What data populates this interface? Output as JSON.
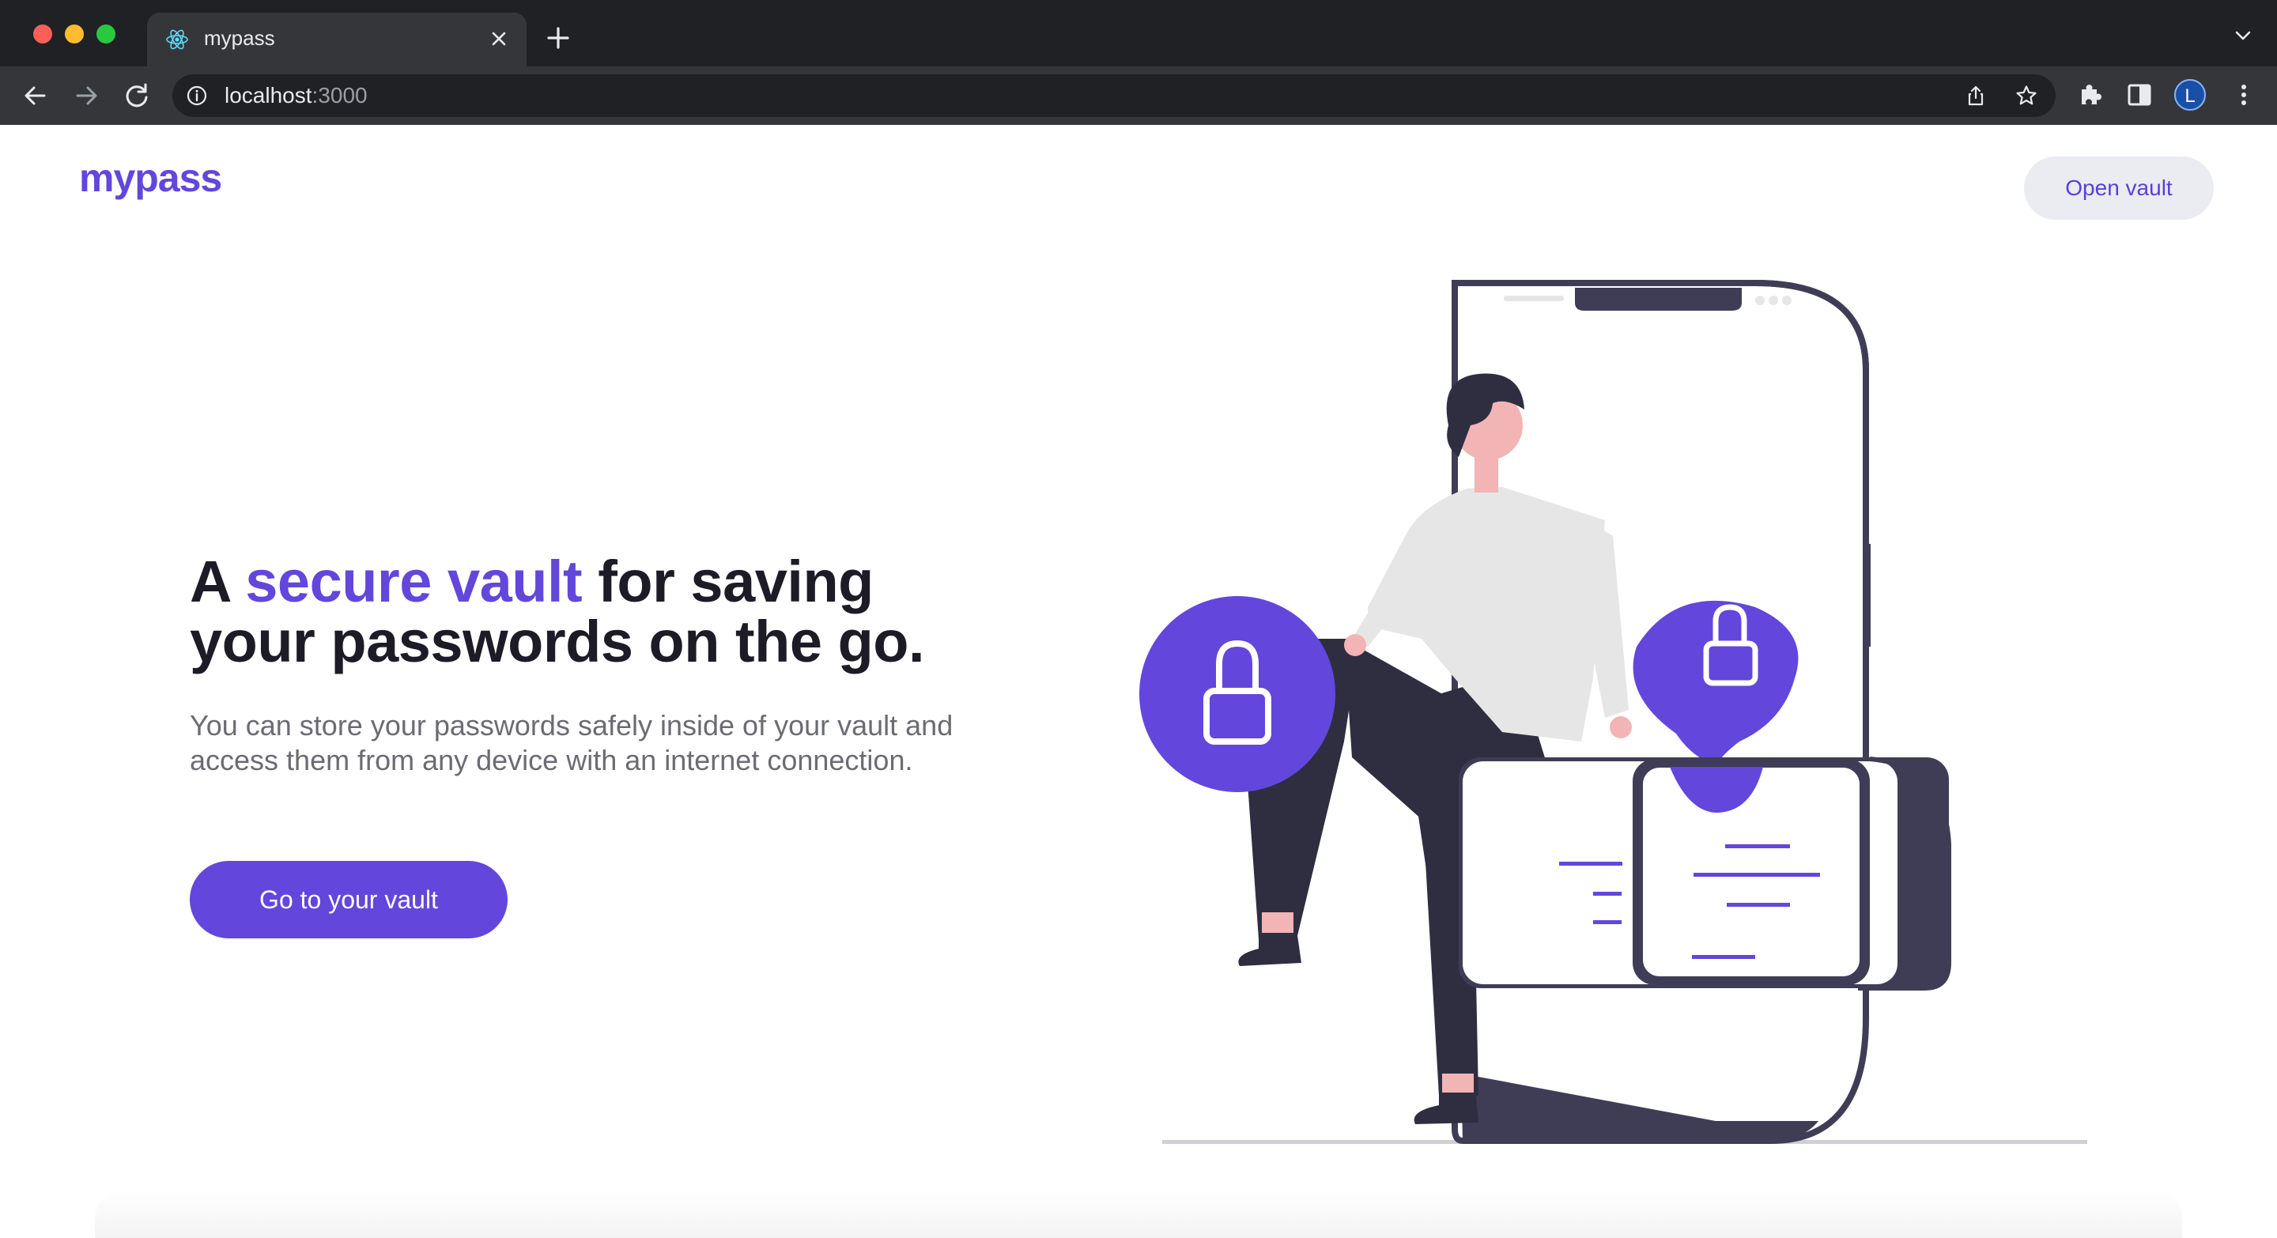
{
  "browser": {
    "tab_title": "mypass",
    "url_host": "localhost",
    "url_port": ":3000",
    "avatar_initial": "L"
  },
  "header": {
    "logo": "mypass",
    "open_vault_label": "Open vault"
  },
  "hero": {
    "title_prefix": "A ",
    "title_accent": "secure vault",
    "title_suffix": " for saving your passwords on the go.",
    "subtitle": "You can store your passwords safely inside of your vault and access them from any device with an internet connection.",
    "cta_label": "Go to your vault"
  },
  "colors": {
    "accent": "#6346dc",
    "accent_light": "#ebebf2",
    "heading": "#1d1b26",
    "body_text": "#6b6b73",
    "chrome_dark": "#202124",
    "chrome_mid": "#35363a"
  },
  "icons": {
    "tab_favicon": "react-atom-icon",
    "back": "arrow-left-icon",
    "forward": "arrow-right-icon",
    "reload": "reload-icon",
    "site_info": "info-icon",
    "share": "share-icon",
    "bookmark": "star-icon",
    "extensions": "puzzle-icon",
    "side_panel": "side-panel-icon",
    "menu": "kebab-menu-icon"
  }
}
